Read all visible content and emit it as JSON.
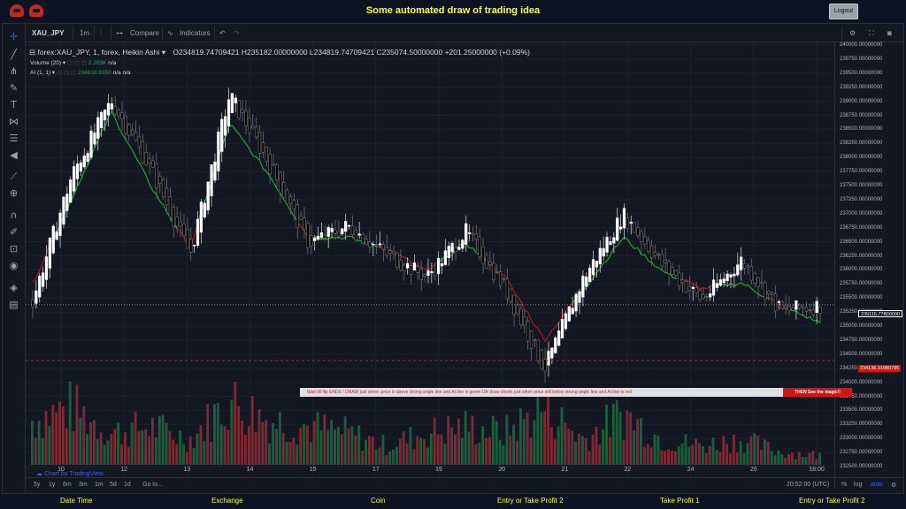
{
  "app": {
    "title": "Some automated draw of trading idea",
    "logout_label": "Logout"
  },
  "colors": {
    "page_bg": "#0d1322",
    "chart_bg": "#131722",
    "title_yellow": "#ffff33",
    "up_candle": "#ffffff",
    "down_candle": "#000000",
    "ai_green": "#1faa2c",
    "ai_red": "#b01a1a",
    "volume_green": "#1b5e3b",
    "volume_red": "#7a2a34"
  },
  "toolbar": {
    "symbol": "XAU_JPY",
    "interval": "1m",
    "compare_label": "Compare",
    "indicators_label": "Indicators"
  },
  "legend": {
    "main": "forex:XAU_JPY, 1, forex, Heikin Ashi",
    "ohlc": "O234819.74709421  H235182.00000000  L234819.74709421  C235074.50000000  +201.25000000 (+0.09%)",
    "volume_name": "Volume (20)",
    "volume_value": "2.203K",
    "volume_na": "n/a",
    "ai_name": "AI (1, 1)",
    "ai_value": "234618.6350",
    "ai_na1": "n/a",
    "ai_na2": "n/a"
  },
  "price_axis": {
    "labels": [
      "240000.00000000",
      "239750.00000000",
      "239500.00000000",
      "239250.00000000",
      "239000.00000000",
      "238750.00000000",
      "238500.00000000",
      "238250.00000000",
      "238000.00000000",
      "237750.00000000",
      "237500.00000000",
      "237250.00000000",
      "237000.00000000",
      "236750.00000000",
      "236500.00000000",
      "236250.00000000",
      "236000.00000000",
      "235750.00000000",
      "235500.00000000",
      "235250.00000000",
      "235000.00000000",
      "234750.00000000",
      "234500.00000000",
      "234250.00000000",
      "234000.00000000",
      "233750.00000000",
      "233500.00000000",
      "233250.00000000",
      "233000.00000000",
      "232750.00000000",
      "232500.00000000"
    ],
    "current_price": "235115.77800000",
    "line_price": "234136.31980795"
  },
  "time_axis": {
    "labels": [
      "10",
      "12",
      "13",
      "14",
      "15",
      "17",
      "19",
      "20",
      "21",
      "22",
      "24",
      "26",
      "18:00"
    ]
  },
  "banner": {
    "text": "Wait till flip ENDS !    DRAW just when:  price is above strong angle line and AI line is green        OR        draw shorts just when price still below strong angle line and AI line is red",
    "highlight": "THEN See the magic!!"
  },
  "watermark": "Chart by TradingView",
  "bottom_bar": {
    "ranges": [
      "5y",
      "1y",
      "6m",
      "3m",
      "1m",
      "5d",
      "1d"
    ],
    "goto_label": "Go to...",
    "clock": "20:52:00 (UTC)",
    "percent_label": "%",
    "log_label": "log",
    "auto_label": "auto"
  },
  "footer": {
    "labels": [
      "Date Time",
      "Exchange",
      "Coin",
      "Entry or Take Profit 2",
      "Take Profit 1",
      "Entry or Take Profit 2"
    ]
  },
  "chart_data": {
    "type": "candlestick",
    "title": "forex:XAU_JPY, 1, forex, Heikin Ashi",
    "ylim": [
      232400,
      240000
    ],
    "x": [
      "10",
      "12",
      "13",
      "14",
      "15",
      "17",
      "19",
      "20",
      "21",
      "22",
      "24",
      "26",
      "18:00"
    ],
    "close": [
      235200,
      237400,
      238700,
      237500,
      236000,
      238800,
      237600,
      236200,
      236500,
      236000,
      235600,
      236400,
      235400,
      234000,
      235600,
      236700,
      235800,
      235200,
      235900,
      235000,
      235100
    ],
    "ai_line": [
      235500,
      237000,
      238500,
      237200,
      236100,
      238300,
      237400,
      236300,
      236300,
      236100,
      235700,
      236200,
      235600,
      234500,
      235400,
      236300,
      235700,
      235400,
      235500,
      235100,
      234800
    ],
    "volume": [
      0.7,
      0.9,
      0.5,
      0.6,
      0.4,
      1.0,
      0.7,
      0.6,
      0.5,
      0.3,
      0.5,
      0.6,
      0.5,
      0.9,
      0.4,
      0.8,
      0.4,
      0.3,
      0.4,
      0.2,
      0.15
    ],
    "marked_level": 234136.31980795,
    "last_price": 235115.778
  }
}
